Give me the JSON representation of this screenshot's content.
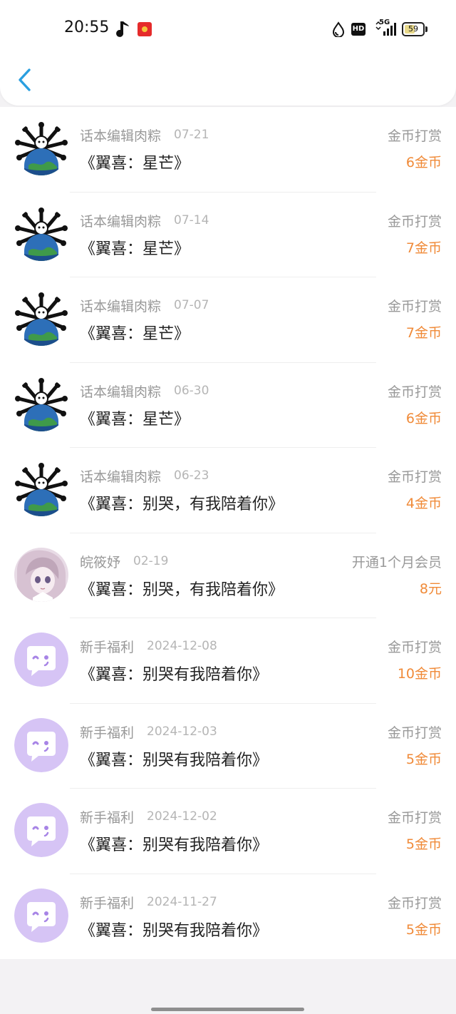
{
  "status_bar": {
    "time": "20:55",
    "network": "5G",
    "hd": "HD",
    "battery": "59",
    "battery_level": 0.59
  },
  "header": {
    "back_icon": "chevron-left-icon"
  },
  "colors": {
    "accent": "#2a9fe0",
    "amount": "#f08a38",
    "muted": "#999999",
    "avatar_purple": "#d6c4f5"
  },
  "records": [
    {
      "name": "话本编辑肉粽",
      "date": "07-21",
      "title": "《翼喜：星芒》",
      "type": "金币打赏",
      "amount": "6金币",
      "avatar": "globe"
    },
    {
      "name": "话本编辑肉粽",
      "date": "07-14",
      "title": "《翼喜：星芒》",
      "type": "金币打赏",
      "amount": "7金币",
      "avatar": "globe"
    },
    {
      "name": "话本编辑肉粽",
      "date": "07-07",
      "title": "《翼喜：星芒》",
      "type": "金币打赏",
      "amount": "7金币",
      "avatar": "globe"
    },
    {
      "name": "话本编辑肉粽",
      "date": "06-30",
      "title": "《翼喜：星芒》",
      "type": "金币打赏",
      "amount": "6金币",
      "avatar": "globe"
    },
    {
      "name": "话本编辑肉粽",
      "date": "06-23",
      "title": "《翼喜：别哭，有我陪着你》",
      "type": "金币打赏",
      "amount": "4金币",
      "avatar": "globe"
    },
    {
      "name": "皖筱妤",
      "date": "02-19",
      "title": "《翼喜：别哭，有我陪着你》",
      "type": "开通1个月会员",
      "amount": "8元",
      "avatar": "anime"
    },
    {
      "name": "新手福利",
      "date": "2024-12-08",
      "title": "《翼喜：别哭有我陪着你》",
      "type": "金币打赏",
      "amount": "10金币",
      "avatar": "chat"
    },
    {
      "name": "新手福利",
      "date": "2024-12-03",
      "title": "《翼喜：别哭有我陪着你》",
      "type": "金币打赏",
      "amount": "5金币",
      "avatar": "chat"
    },
    {
      "name": "新手福利",
      "date": "2024-12-02",
      "title": "《翼喜：别哭有我陪着你》",
      "type": "金币打赏",
      "amount": "5金币",
      "avatar": "chat"
    },
    {
      "name": "新手福利",
      "date": "2024-11-27",
      "title": "《翼喜：别哭有我陪着你》",
      "type": "金币打赏",
      "amount": "5金币",
      "avatar": "chat"
    }
  ]
}
